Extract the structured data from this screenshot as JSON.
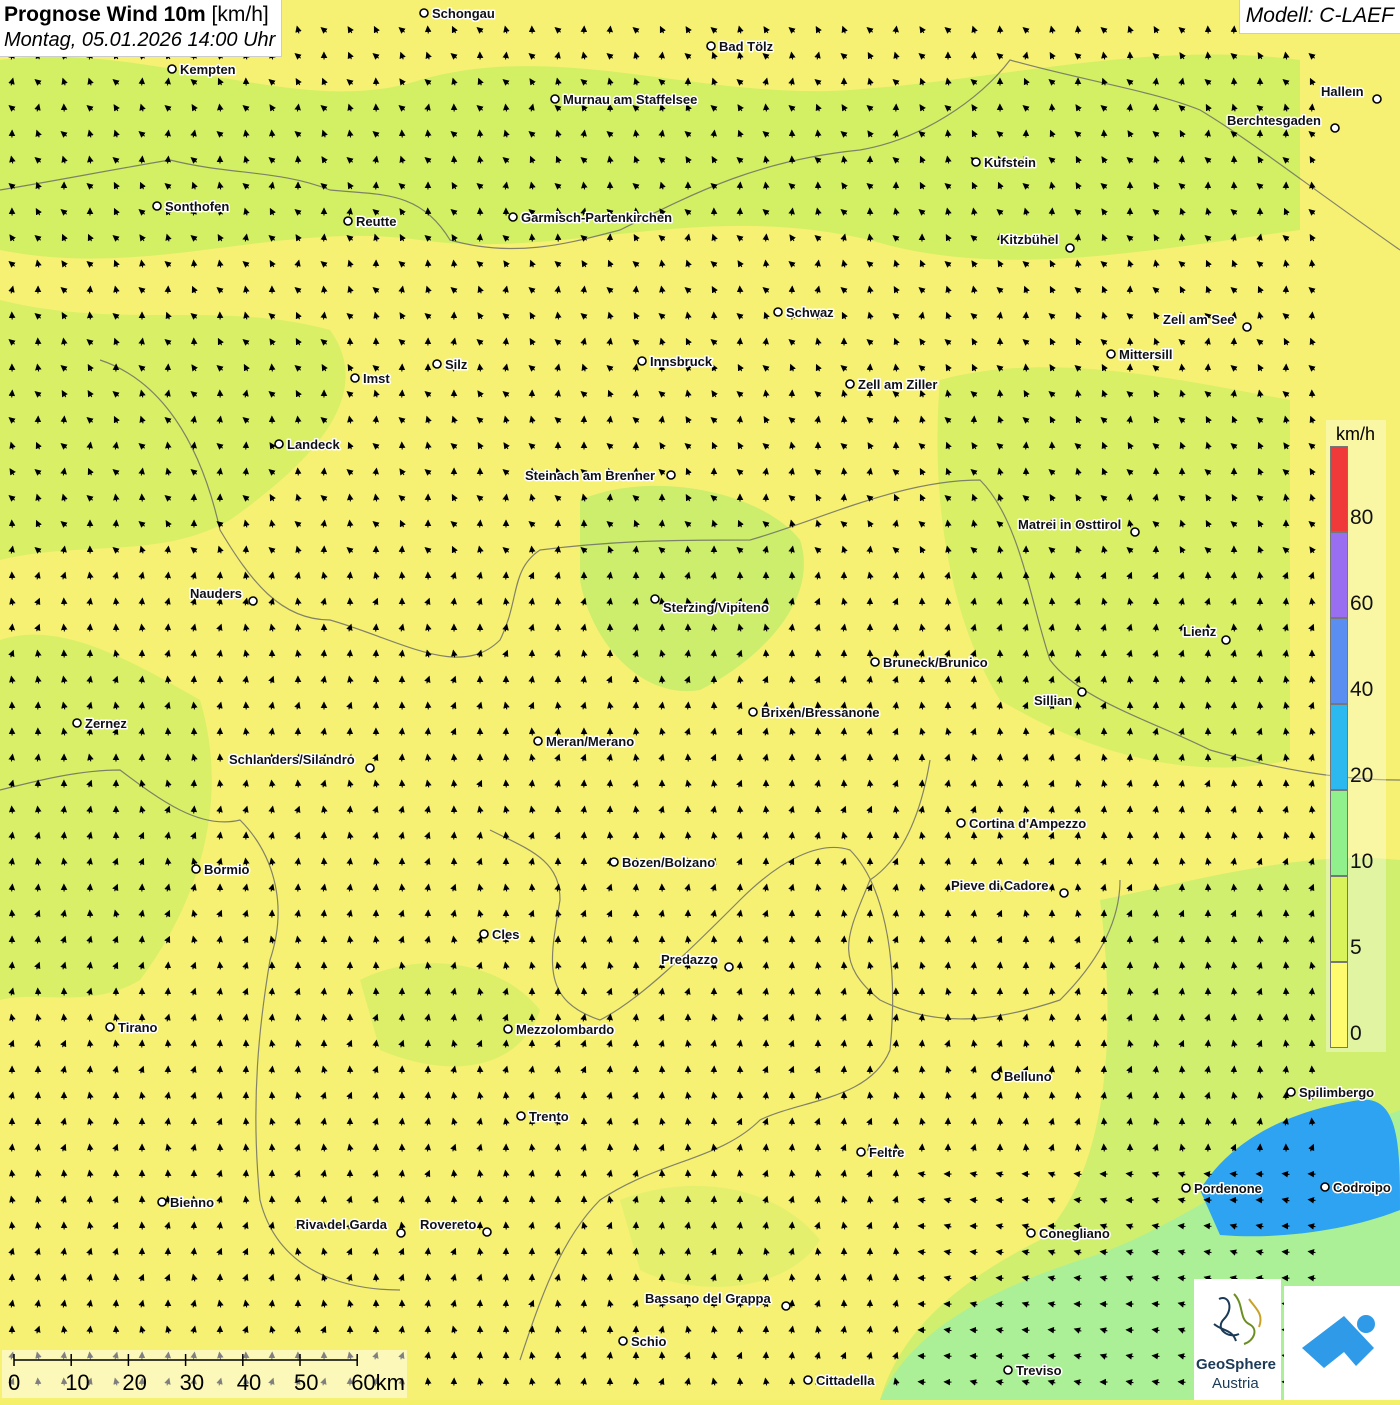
{
  "header": {
    "title_bold": "Prognose Wind 10m",
    "title_unit": "[km/h]",
    "datetime": "Montag, 05.01.2026 14:00 Uhr"
  },
  "model": {
    "label": "Modell: C-LAEF"
  },
  "legend": {
    "unit": "km/h",
    "classes": [
      {
        "label": "0",
        "color": "#fffb6e"
      },
      {
        "label": "5",
        "color": "#d8f45a"
      },
      {
        "label": "10",
        "color": "#8ff08c"
      },
      {
        "label": "20",
        "color": "#2bb9f0"
      },
      {
        "label": "40",
        "color": "#5a8ef0"
      },
      {
        "label": "60",
        "color": "#9a6ef0"
      },
      {
        "label": "80",
        "color": "#f03a3a"
      }
    ]
  },
  "scalebar": {
    "labels": [
      "0",
      "10",
      "20",
      "30",
      "40",
      "50",
      "60km"
    ]
  },
  "cities": [
    "Schongau",
    "Bad Tölz",
    "Kempten",
    "Murnau am Staffelsee",
    "Halleın",
    "Berchtesgaden",
    "Kufstein",
    "Sonthofen",
    "Reutte",
    "Garmisch-Partenkirchen",
    "Kitzbühel",
    "Schwaz",
    "Zell am See",
    "Mittersill",
    "Innsbruck",
    "Silz",
    "Imst",
    "Zell am Ziller",
    "Landeck",
    "Steinach am Brenner",
    "Matrei in Osttirol",
    "Nauders",
    "Sterzing/Vipiteno",
    "Lienz",
    "Bruneck/Brunico",
    "Sillian",
    "Brixen/Bressanone",
    "Zernez",
    "Meran/Merano",
    "Schlanders/Silandro",
    "Cortina d'Ampezzo",
    "Bozen/Bolzano",
    "Bormio",
    "Pieve di Cadore",
    "Cles",
    "Predazzo",
    "Tirano",
    "Mezzolombardo",
    "Belluno",
    "Spilimbergo",
    "Trento",
    "Feltre",
    "Pordenone",
    "Codroipo",
    "Bienno",
    "Riva del Garda",
    "Rovereto",
    "Conegliano",
    "Bassano del Grappa",
    "Schio",
    "Treviso",
    "Cittadella"
  ],
  "logo": {
    "name_line1": "GeoSphere",
    "name_line2": "Austria"
  },
  "colors": {
    "wind_low": "#fffb6e",
    "wind_mid": "#d8f45a",
    "wind_high": "#a8f09a",
    "sea": "#2ea3f2"
  }
}
